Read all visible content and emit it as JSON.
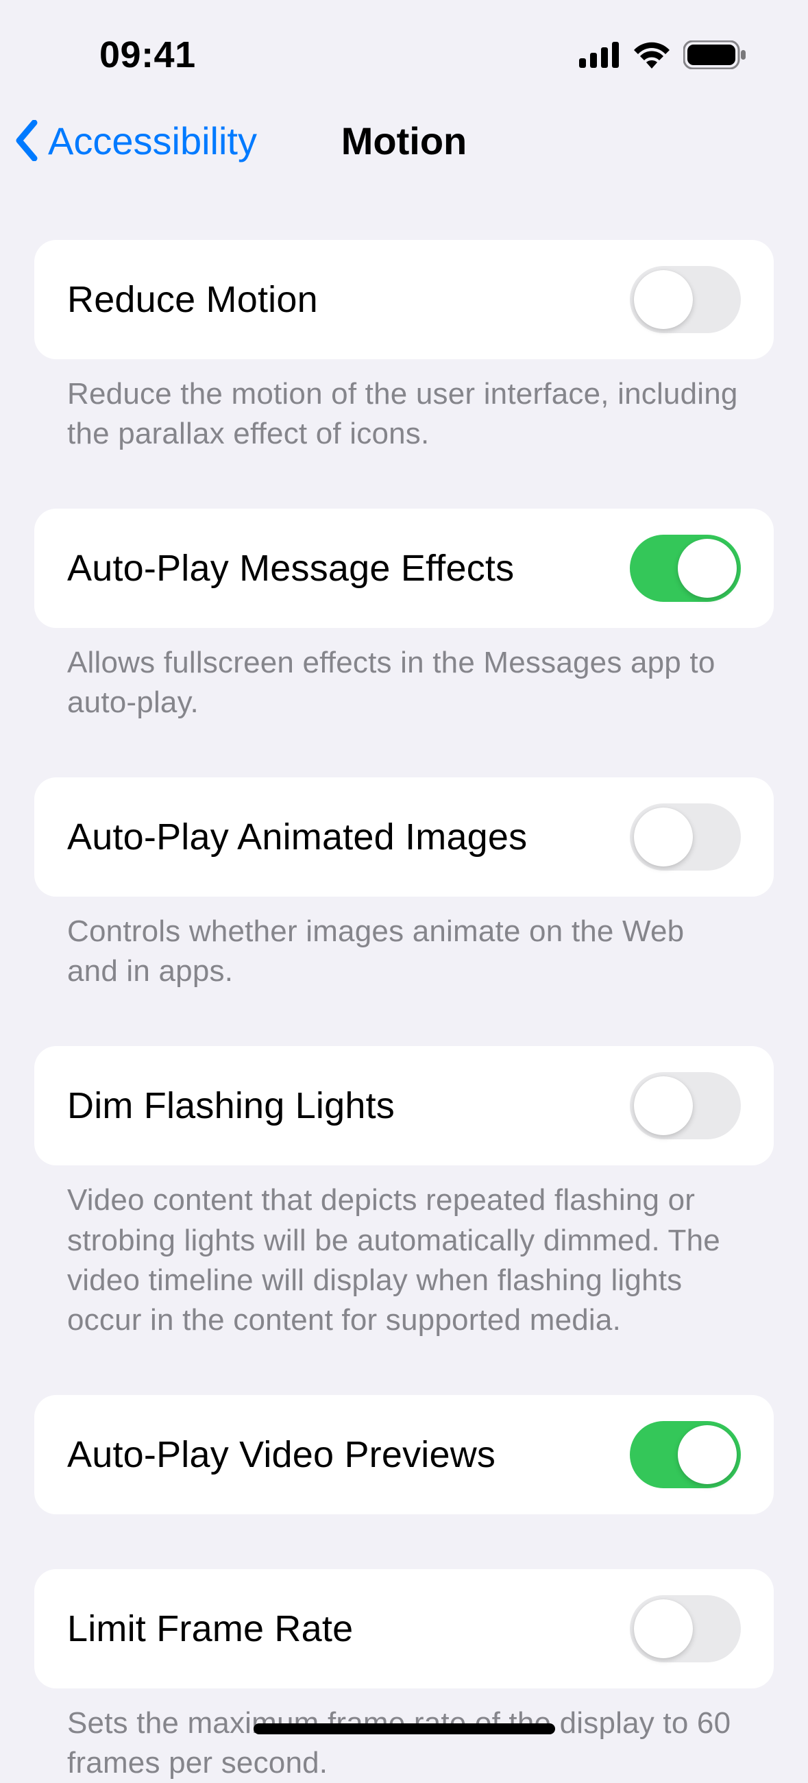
{
  "status": {
    "time": "09:41"
  },
  "nav": {
    "back_label": "Accessibility",
    "title": "Motion"
  },
  "groups": [
    {
      "id": "reduce-motion",
      "label": "Reduce Motion",
      "on": false,
      "footer": "Reduce the motion of the user interface, including the parallax effect of icons."
    },
    {
      "id": "autoplay-message-effects",
      "label": "Auto-Play Message Effects",
      "on": true,
      "footer": "Allows fullscreen effects in the Messages app to auto-play."
    },
    {
      "id": "autoplay-animated-images",
      "label": "Auto-Play Animated Images",
      "on": false,
      "footer": "Controls whether images animate on the Web and in apps."
    },
    {
      "id": "dim-flashing-lights",
      "label": "Dim Flashing Lights",
      "on": false,
      "footer": "Video content that depicts repeated flashing or strobing lights will be automatically dimmed. The video timeline will display when flashing lights occur in the content for supported media."
    },
    {
      "id": "autoplay-video-previews",
      "label": "Auto-Play Video Previews",
      "on": true,
      "footer": ""
    },
    {
      "id": "limit-frame-rate",
      "label": "Limit Frame Rate",
      "on": false,
      "footer": "Sets the maximum frame rate of the display to 60 frames per second."
    }
  ]
}
